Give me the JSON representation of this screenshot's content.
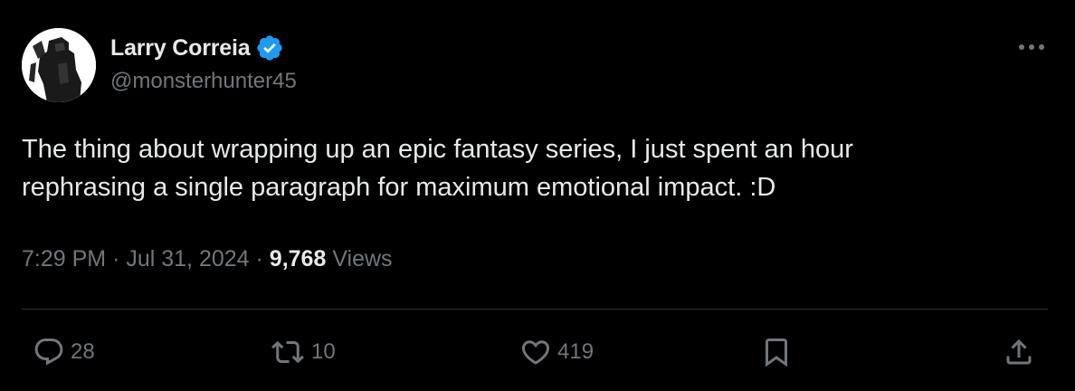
{
  "author": {
    "display_name": "Larry Correia",
    "handle": "@monsterhunter45",
    "verified": true
  },
  "tweet": {
    "text": "The thing about wrapping up an epic fantasy series, I just spent an hour\nrephrasing a single paragraph for maximum emotional impact. :D",
    "time": "7:29 PM",
    "separator": "·",
    "date": "Jul 31, 2024",
    "views_count": "9,768",
    "views_label": "Views"
  },
  "actions": {
    "replies": "28",
    "reposts": "10",
    "likes": "419"
  },
  "icons": {
    "more": "more-horizontal-icon",
    "reply": "reply-bubble-icon",
    "repost": "repost-arrows-icon",
    "like": "heart-icon",
    "bookmark": "bookmark-icon",
    "share": "share-upload-icon",
    "verified": "verified-badge-icon"
  },
  "colors": {
    "background": "#000000",
    "primary_text": "#e7e9ea",
    "secondary_text": "#71767b",
    "verified_blue": "#1d9bf0",
    "divider": "#2f3336"
  }
}
